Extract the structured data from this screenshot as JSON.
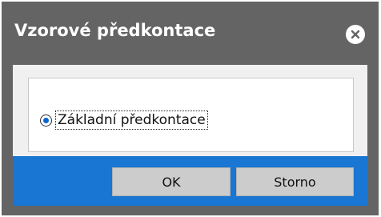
{
  "dialog": {
    "title": "Vzorové předkontace",
    "close_icon": "close-icon"
  },
  "options": [
    {
      "label": "Základní předkontace",
      "selected": true
    }
  ],
  "buttons": {
    "ok_label": "OK",
    "cancel_label": "Storno"
  },
  "colors": {
    "titlebar": "#646464",
    "footer": "#1976d2",
    "radio_accent": "#0a64d2"
  }
}
